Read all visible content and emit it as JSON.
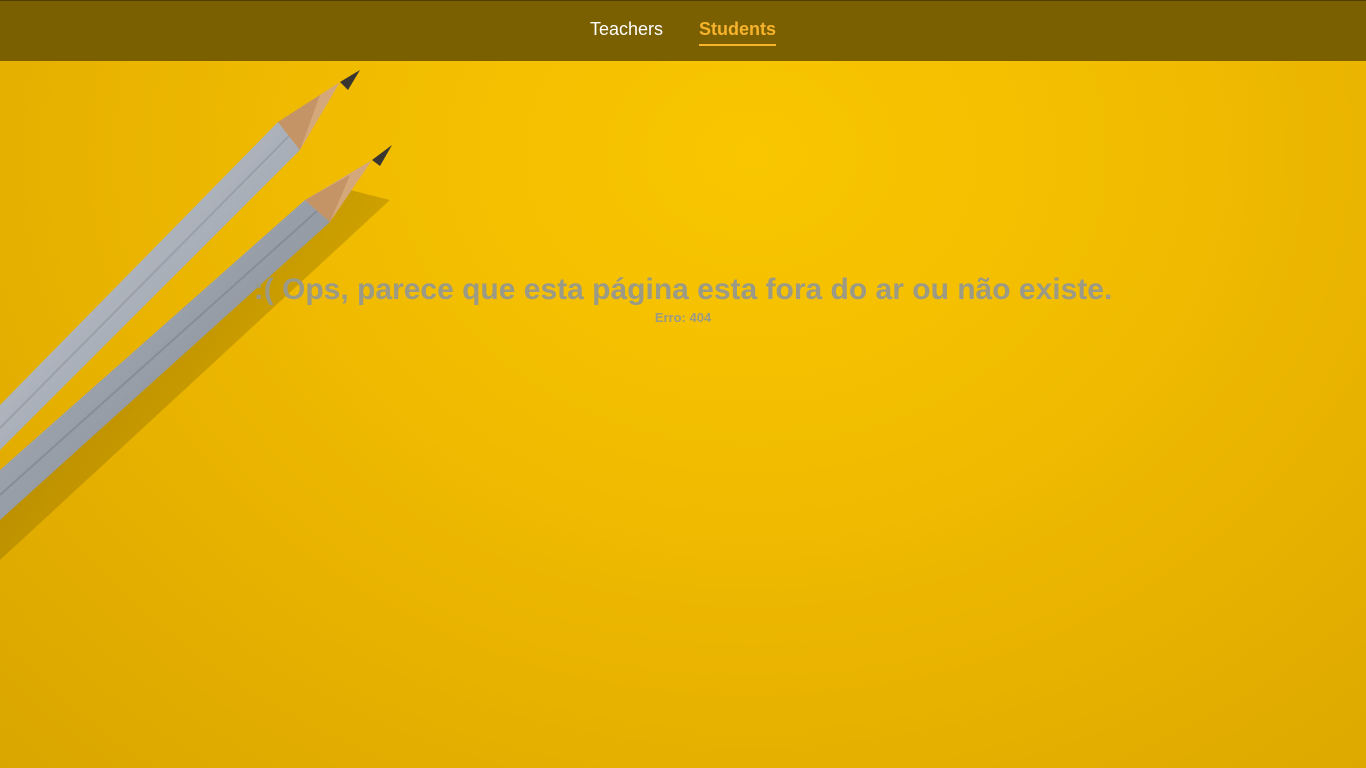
{
  "nav": {
    "items": [
      {
        "label": "Teachers",
        "active": false
      },
      {
        "label": "Students",
        "active": true
      }
    ],
    "active_color": "#f7b32b",
    "bar_color": "#7a6000"
  },
  "error": {
    "message": ":( Ops, parece que esta página esta fora do ar ou não existe.",
    "code": "Erro: 404"
  },
  "background": {
    "color": "#f2bd00",
    "icons": [
      "pencil-icon",
      "pencil-icon"
    ]
  }
}
